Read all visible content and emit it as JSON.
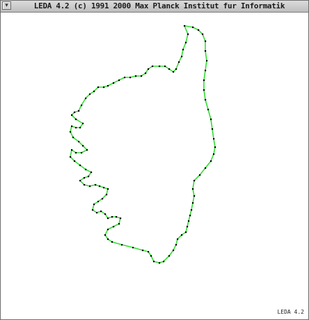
{
  "window": {
    "title": "LEDA 4.2 (c) 1991  2000 Max  Planck  Institut fur Informatik",
    "menu_glyph": "▾"
  },
  "footer": {
    "version_label": "LEDA 4.2"
  },
  "colors": {
    "polygon_edge": "#33dd33",
    "vertex": "#000000",
    "background": "#ffffff"
  },
  "map": {
    "shape": "corsica-outline",
    "vertex_count": 120
  }
}
